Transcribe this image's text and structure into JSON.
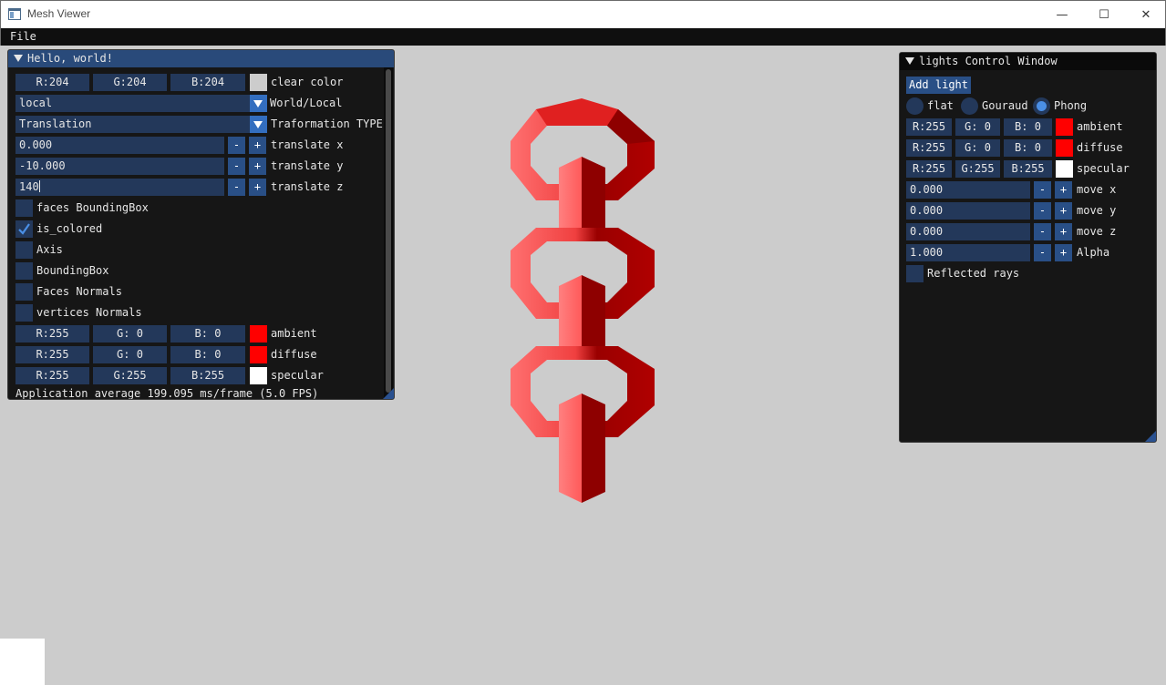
{
  "window": {
    "title": "Mesh Viewer",
    "minimize": "—",
    "maximize": "☐",
    "close": "✕"
  },
  "menu": {
    "file": "File"
  },
  "hello": {
    "title": "Hello, world!",
    "clear_color": {
      "r": "R:204",
      "g": "G:204",
      "b": "B:204",
      "label": "clear color",
      "swatch": "#cccccc"
    },
    "world_local": {
      "value": "local",
      "label": "World/Local"
    },
    "transform_type": {
      "value": "Translation",
      "label": "Traformation TYPE"
    },
    "translate_x": {
      "value": "0.000",
      "minus": "-",
      "plus": "+",
      "label": "translate x"
    },
    "translate_y": {
      "value": "-10.000",
      "minus": "-",
      "plus": "+",
      "label": "translate y"
    },
    "translate_z": {
      "value": "140",
      "minus": "-",
      "plus": "+",
      "label": "translate z"
    },
    "checks": [
      {
        "label": "faces BoundingBox",
        "checked": false
      },
      {
        "label": "is_colored",
        "checked": true
      },
      {
        "label": "Axis",
        "checked": false
      },
      {
        "label": "BoundingBox",
        "checked": false
      },
      {
        "label": "Faces Normals",
        "checked": false
      },
      {
        "label": "vertices Normals",
        "checked": false
      }
    ],
    "ambient": {
      "r": "R:255",
      "g": "G:  0",
      "b": "B:  0",
      "label": "ambient",
      "swatch": "#ff0000"
    },
    "diffuse": {
      "r": "R:255",
      "g": "G:  0",
      "b": "B:  0",
      "label": "diffuse",
      "swatch": "#ff0000"
    },
    "specular": {
      "r": "R:255",
      "g": "G:255",
      "b": "B:255",
      "label": "specular",
      "swatch": "#ffffff"
    },
    "status": "Application average 199.095 ms/frame (5.0 FPS)"
  },
  "lights": {
    "title": "lights Control Window",
    "add_light": "Add light",
    "shading": [
      {
        "label": "flat",
        "selected": false
      },
      {
        "label": "Gouraud",
        "selected": false
      },
      {
        "label": "Phong",
        "selected": true
      }
    ],
    "ambient": {
      "r": "R:255",
      "g": "G:  0",
      "b": "B:  0",
      "label": "ambient",
      "swatch": "#ff0000"
    },
    "diffuse": {
      "r": "R:255",
      "g": "G:  0",
      "b": "B:  0",
      "label": "diffuse",
      "swatch": "#ff0000"
    },
    "specular": {
      "r": "R:255",
      "g": "G:255",
      "b": "B:255",
      "label": "specular",
      "swatch": "#ffffff"
    },
    "move_x": {
      "value": "0.000",
      "minus": "-",
      "plus": "+",
      "label": "move x"
    },
    "move_y": {
      "value": "0.000",
      "minus": "-",
      "plus": "+",
      "label": "move y"
    },
    "move_z": {
      "value": "0.000",
      "minus": "-",
      "plus": "+",
      "label": "move z"
    },
    "alpha": {
      "value": "1.000",
      "minus": "-",
      "plus": "+",
      "label": "Alpha"
    },
    "reflected": {
      "label": "Reflected rays",
      "checked": false
    }
  },
  "colors": {
    "frame_bg": "#23385a",
    "button": "#294f86",
    "title_active": "#294a7a",
    "title_inactive": "#0a0a0a",
    "mesh_light": "#ff6b6b",
    "mesh_dark": "#8e0000"
  }
}
